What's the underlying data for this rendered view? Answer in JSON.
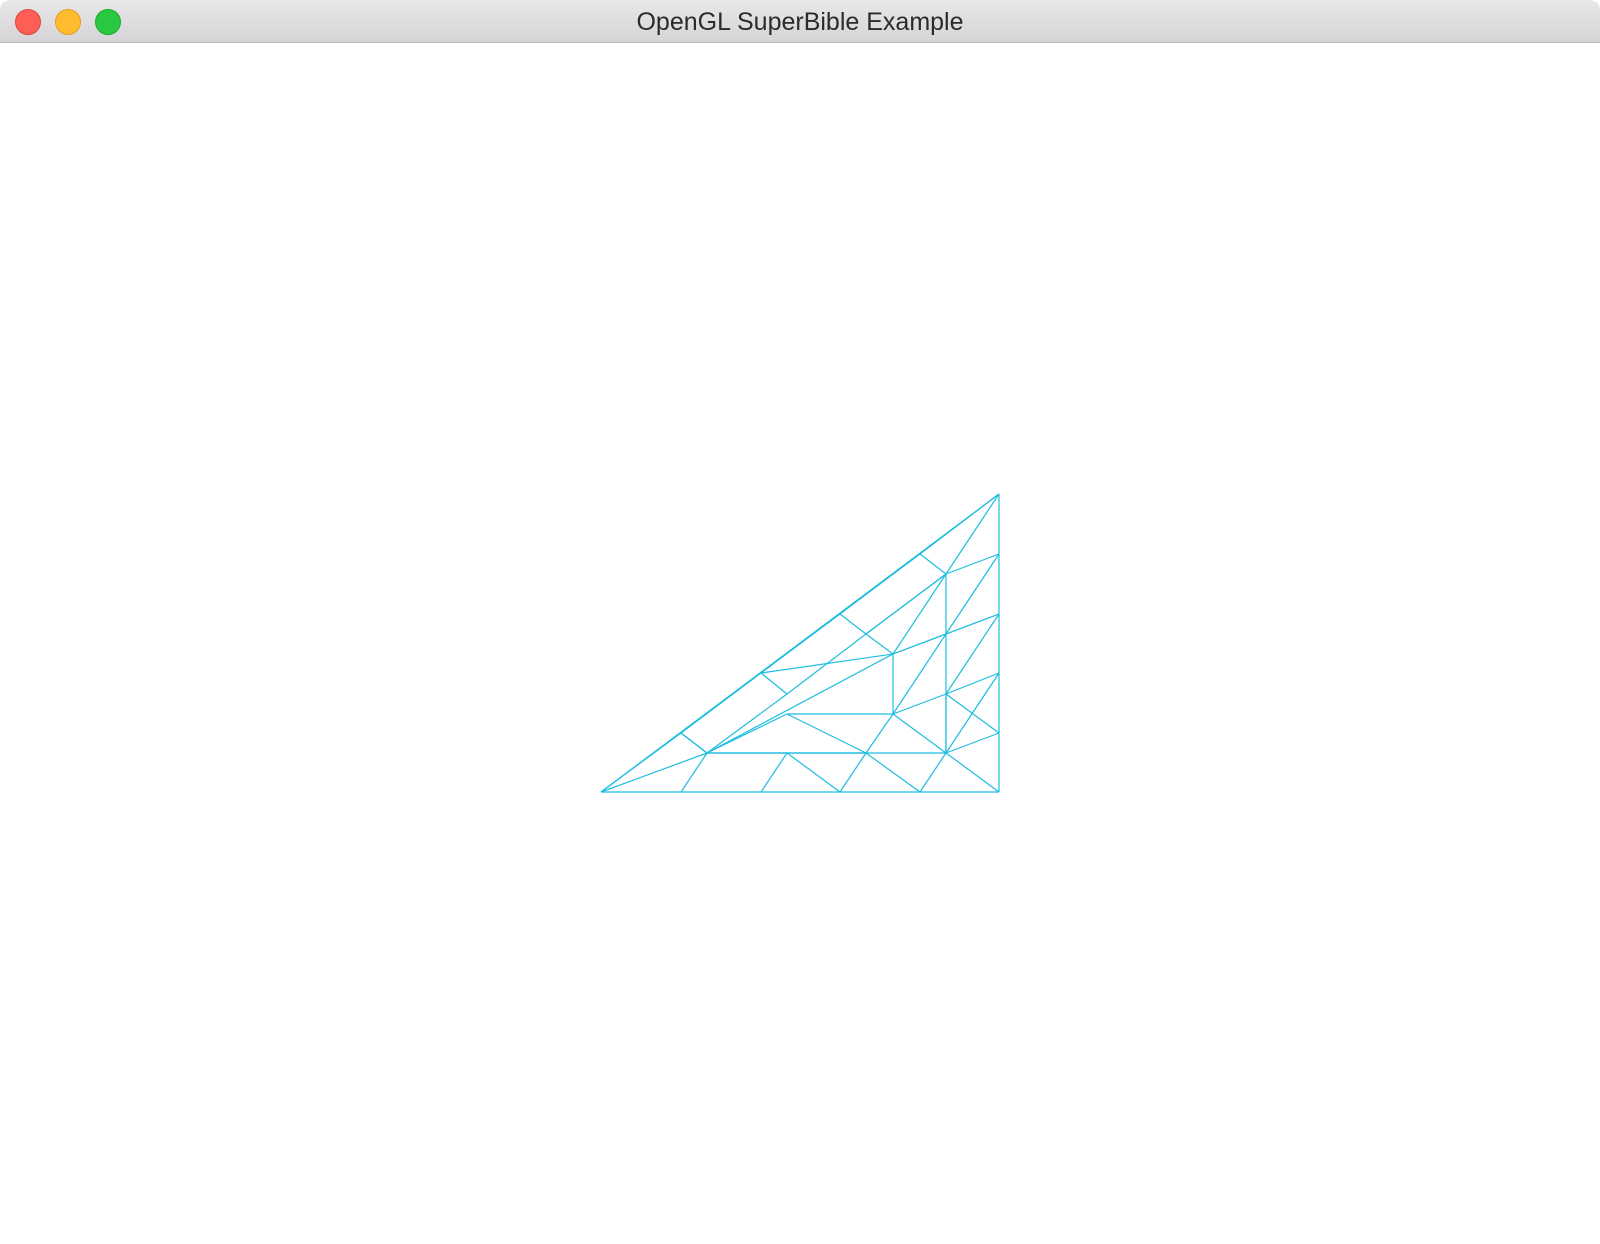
{
  "window": {
    "title": "OpenGL SuperBible Example",
    "controls": {
      "close": "close-window",
      "minimize": "minimize-window",
      "zoom": "zoom-window"
    }
  },
  "render": {
    "line_color": "#1ebde0",
    "background_color": "#ffffff"
  }
}
